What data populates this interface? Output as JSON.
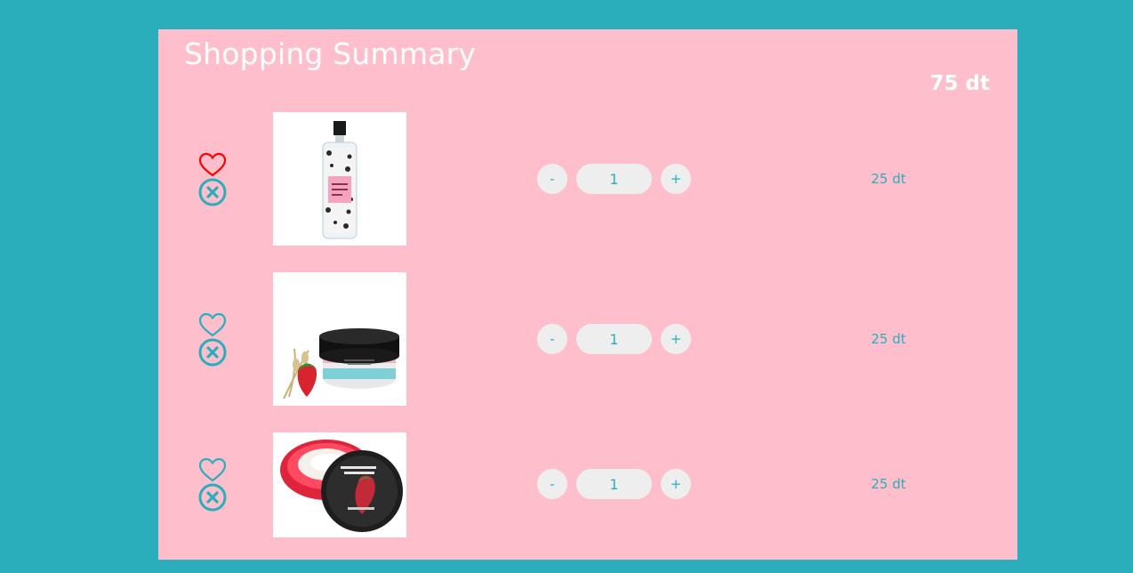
{
  "header": {
    "title": "Shopping Summary",
    "total": "75 dt"
  },
  "colors": {
    "background": "#2aaebb",
    "card": "#ffbecb",
    "accent": "#2aaebb",
    "liked": "#ff0000"
  },
  "items": [
    {
      "image": "body-mist-bottle",
      "liked": true,
      "quantity": "1",
      "minus_label": "-",
      "plus_label": "+",
      "price": "25 dt"
    },
    {
      "image": "vitamin-e-cream-jar",
      "liked": false,
      "quantity": "1",
      "minus_label": "-",
      "plus_label": "+",
      "price": "25 dt"
    },
    {
      "image": "strawberry-body-butter-jar",
      "liked": false,
      "quantity": "1",
      "minus_label": "-",
      "plus_label": "+",
      "price": "25 dt"
    }
  ]
}
